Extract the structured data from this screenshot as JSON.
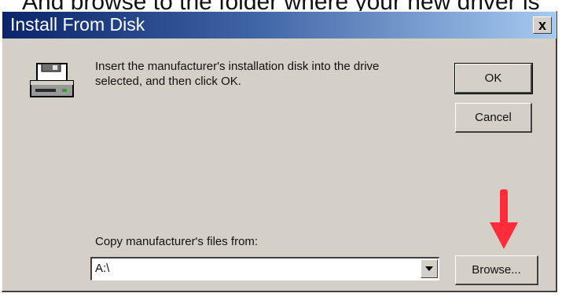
{
  "caption": {
    "text": "And browse to the folder where your new driver is"
  },
  "window": {
    "title": "Install From Disk",
    "close_label": "x"
  },
  "dialog": {
    "message_line1": "Insert the manufacturer's installation disk into the drive",
    "message_line2": "selected, and then click OK.",
    "ok_label": "OK",
    "cancel_label": "Cancel",
    "copy_label": "Copy manufacturer's files from:",
    "path_value": "A:\\",
    "browse_label": "Browse..."
  },
  "icons": {
    "disk": "floppy-drive-icon",
    "dropdown": "chevron-down-icon",
    "annotation": "red-arrow-down-icon"
  },
  "colors": {
    "titlebar_start": "#0a246a",
    "titlebar_end": "#a6caf0",
    "dialog_face": "#d4d0c8",
    "annotation_arrow": "#ff2d3c"
  }
}
